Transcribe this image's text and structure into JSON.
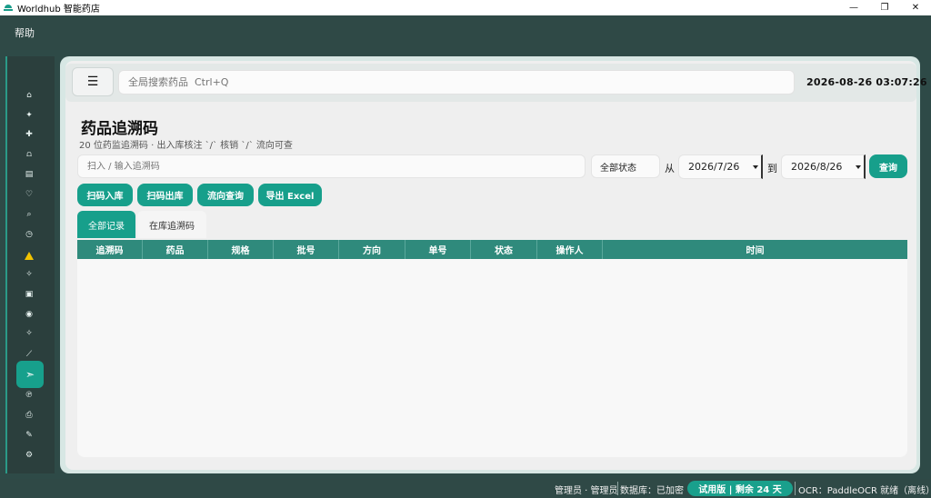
{
  "window": {
    "title": "Worldhub 智能药店",
    "controls": [
      "—",
      "❐",
      "✕"
    ]
  },
  "menubar": {
    "help": "帮助"
  },
  "sidebar": {
    "icons": [
      {
        "name": "home-icon",
        "glyph": "⌂"
      },
      {
        "name": "sparkle-icon",
        "glyph": "✦"
      },
      {
        "name": "medical-cross-icon",
        "glyph": "✚"
      },
      {
        "name": "bell-icon",
        "glyph": "⩍"
      },
      {
        "name": "document-icon",
        "glyph": "▤"
      },
      {
        "name": "heart-icon",
        "glyph": "♡"
      },
      {
        "name": "search-icon",
        "glyph": "⌕"
      },
      {
        "name": "clock-icon",
        "glyph": "◷"
      },
      {
        "name": "warning-icon",
        "glyph": "!"
      },
      {
        "name": "pill-icon",
        "glyph": "✧"
      },
      {
        "name": "box-icon",
        "glyph": "▣"
      },
      {
        "name": "drop-icon",
        "glyph": "◉"
      },
      {
        "name": "star-icon",
        "glyph": "✧"
      },
      {
        "name": "edit-icon",
        "glyph": "⟋"
      },
      {
        "name": "send-icon",
        "glyph": "➣"
      },
      {
        "name": "tag-icon",
        "glyph": "℗"
      },
      {
        "name": "printer-icon",
        "glyph": "⎙"
      },
      {
        "name": "pen-icon",
        "glyph": "✎"
      },
      {
        "name": "settings-icon",
        "glyph": "⚙"
      }
    ]
  },
  "header": {
    "menu_glyph": "☰",
    "search_placeholder": "全局搜索药品  Ctrl+Q",
    "datetime": "2026-08-26  03:07:26"
  },
  "page": {
    "title": "药品追溯码",
    "subtitle": "20 位药监追溯码 · 出入库核注 `/` 核销 `/` 流向可查"
  },
  "filters": {
    "scan_placeholder": "扫入 / 输入追溯码",
    "status_value": "全部状态",
    "from_label": "从",
    "date_from": "2026/7/26",
    "to_label": "到",
    "date_to": "2026/8/26",
    "query_label": "查询"
  },
  "actions": {
    "scan_in": "扫码入库",
    "scan_out": "扫码出库",
    "flow_query": "流向查询",
    "export_excel": "导出 Excel"
  },
  "tabs": {
    "all_records": "全部记录",
    "in_stock_trace": "在库追溯码"
  },
  "table": {
    "columns": [
      "追溯码",
      "药品",
      "规格",
      "批号",
      "方向",
      "单号",
      "状态",
      "操作人",
      "时间"
    ],
    "rows": []
  },
  "statusbar": {
    "user": "管理员 · 管理员",
    "database": "数据库：已加密",
    "trial": "试用版 | 剩余 24 天",
    "ocr": "OCR：PaddleOCR 就绪（离线）"
  },
  "colors": {
    "accent": "#179f8b",
    "table_header": "#2f8a7c",
    "chrome_dark": "#2f4946",
    "warning": "#f2c300"
  }
}
